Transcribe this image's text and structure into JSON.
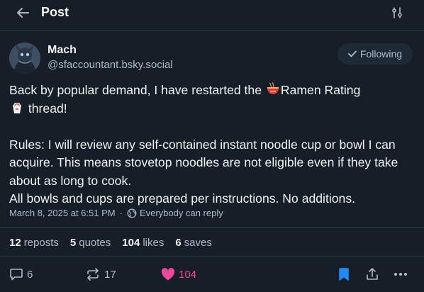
{
  "header": {
    "title": "Post"
  },
  "author": {
    "name": "Mach",
    "handle": "@sfaccountant.bsky.social",
    "follow_label": "Following"
  },
  "post": {
    "line1_a": "Back by popular demand, I have restarted the ",
    "line1_b": "Ramen Rating",
    "line2": " thread!",
    "rules": "Rules: I will review any self-contained instant noodle cup or bowl I can acquire. This means stovetop noodles are not eligible even if they take about as long to cook.\nAll bowls and cups are prepared per instructions. No additions."
  },
  "meta": {
    "timestamp": "March 8, 2025 at 6:51 PM",
    "separator": "·",
    "reply_setting": "Everybody can reply"
  },
  "stats": {
    "reposts_count": "12",
    "reposts_label": "reposts",
    "quotes_count": "5",
    "quotes_label": "quotes",
    "likes_count": "104",
    "likes_label": "likes",
    "saves_count": "6",
    "saves_label": "saves"
  },
  "actions": {
    "replies": "6",
    "reposts": "17",
    "likes": "104"
  },
  "colors": {
    "background": "#161e27",
    "divider": "#2e4052",
    "accent": "#208bfe",
    "like": "#ec4899",
    "muted": "#aebbc9"
  },
  "icons": [
    "back-arrow-icon",
    "settings-sliders-icon",
    "check-icon",
    "ramen-emoji",
    "takeout-box-emoji",
    "globe-icon",
    "reply-icon",
    "repost-icon",
    "heart-icon",
    "bookmark-icon",
    "share-icon",
    "more-icon"
  ]
}
